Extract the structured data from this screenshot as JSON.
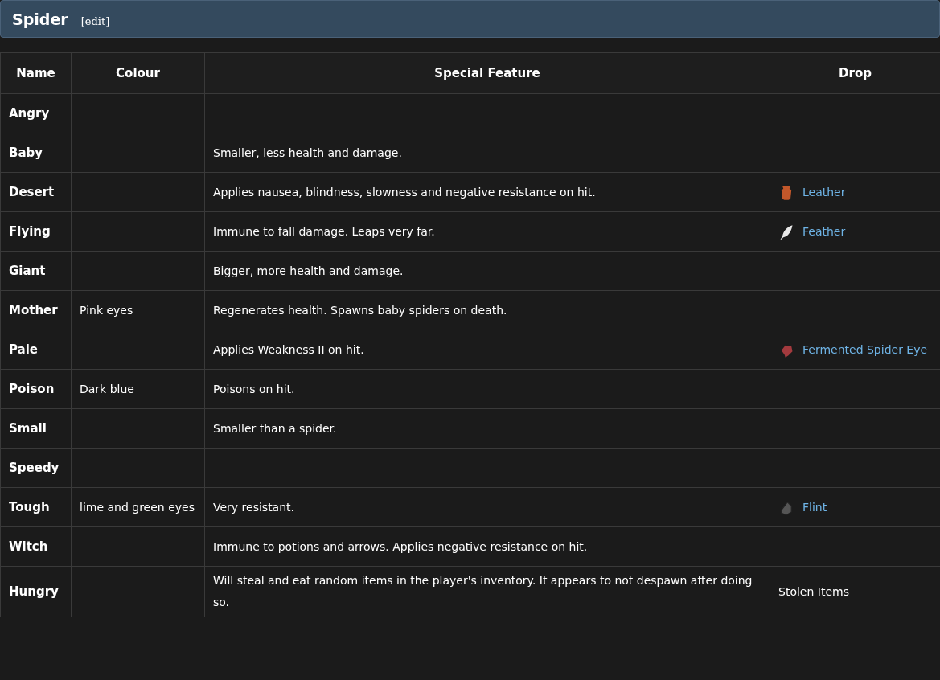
{
  "section": {
    "title": "Spider",
    "edit": "[edit]"
  },
  "table": {
    "columns": [
      "Name",
      "Colour",
      "Special Feature",
      "Drop"
    ],
    "rows": [
      {
        "name": "Angry"
      },
      {
        "name": "Baby",
        "feature": "Smaller, less health and damage."
      },
      {
        "name": "Desert",
        "feature": "Applies nausea, blindness, slowness and negative resistance on hit.",
        "drop": {
          "kind": "leather",
          "text": "Leather"
        }
      },
      {
        "name": "Flying",
        "feature": "Immune to fall damage. Leaps very far.",
        "drop": {
          "kind": "feather",
          "text": "Feather"
        }
      },
      {
        "name": "Giant",
        "feature": "Bigger, more health and damage."
      },
      {
        "name": "Mother",
        "colour": "Pink eyes",
        "feature": "Regenerates health. Spawns baby spiders on death."
      },
      {
        "name": "Pale",
        "feature": "Applies Weakness II on hit.",
        "drop": {
          "kind": "eye",
          "text": "Fermented Spider Eye"
        }
      },
      {
        "name": "Poison",
        "colour": "Dark blue",
        "feature": "Poisons on hit."
      },
      {
        "name": "Small",
        "feature": "Smaller than a spider."
      },
      {
        "name": "Speedy"
      },
      {
        "name": "Tough",
        "colour": "lime and green eyes",
        "feature": "Very resistant.",
        "drop": {
          "kind": "flint",
          "text": "Flint"
        }
      },
      {
        "name": "Witch",
        "feature": "Immune to potions and arrows. Applies negative resistance on hit."
      },
      {
        "name": "Hungry",
        "feature": "Will steal and eat random items in the player's inventory. It appears to not despawn after doing so.",
        "drop": {
          "kind": "plain",
          "text": "Stolen Items"
        }
      }
    ]
  }
}
